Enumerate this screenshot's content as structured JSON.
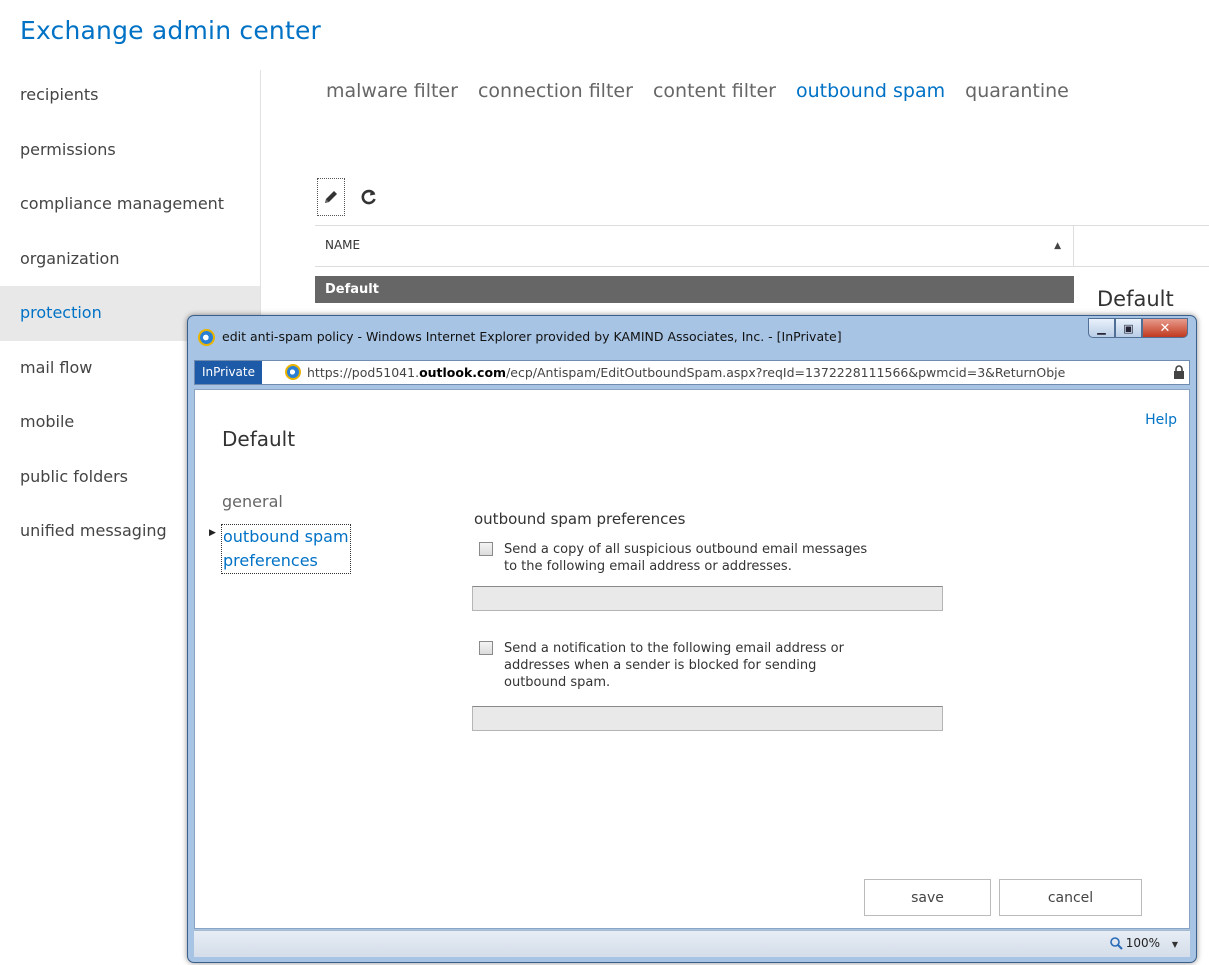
{
  "eac": {
    "title": "Exchange admin center",
    "nav": [
      "recipients",
      "permissions",
      "compliance management",
      "organization",
      "protection",
      "mail flow",
      "mobile",
      "public folders",
      "unified messaging"
    ],
    "active_nav": "protection",
    "tabs": [
      "malware filter",
      "connection filter",
      "content filter",
      "outbound spam",
      "quarantine"
    ],
    "active_tab": "outbound spam",
    "grid": {
      "column": "NAME",
      "sort_indicator": "▲",
      "selected_row": "Default"
    },
    "detail_title": "Default"
  },
  "popup": {
    "window_title": "edit anti-spam policy - Windows Internet Explorer provided by KAMIND Associates, Inc. - [InPrivate]",
    "inprivate_label": "InPrivate",
    "url_prefix": "https://pod51041.",
    "url_domain": "outlook.com",
    "url_suffix": "/ecp/Antispam/EditOutboundSpam.aspx?reqId=1372228111566&pwmcid=3&ReturnObje",
    "help": "Help",
    "page_title": "Default",
    "side_general": "general",
    "side_active_line1": "outbound spam",
    "side_active_line2": "preferences",
    "section_title": "outbound spam preferences",
    "option1": {
      "line1": "Send a copy of all suspicious outbound email messages",
      "line2": "to the following email address or addresses.",
      "checked": false,
      "value": ""
    },
    "option2": {
      "line1": "Send a notification to the following email address or",
      "line2": "addresses when a sender is blocked for sending",
      "line3": "outbound spam.",
      "checked": false,
      "value": ""
    },
    "save": "save",
    "cancel": "cancel",
    "zoom": "100%"
  }
}
